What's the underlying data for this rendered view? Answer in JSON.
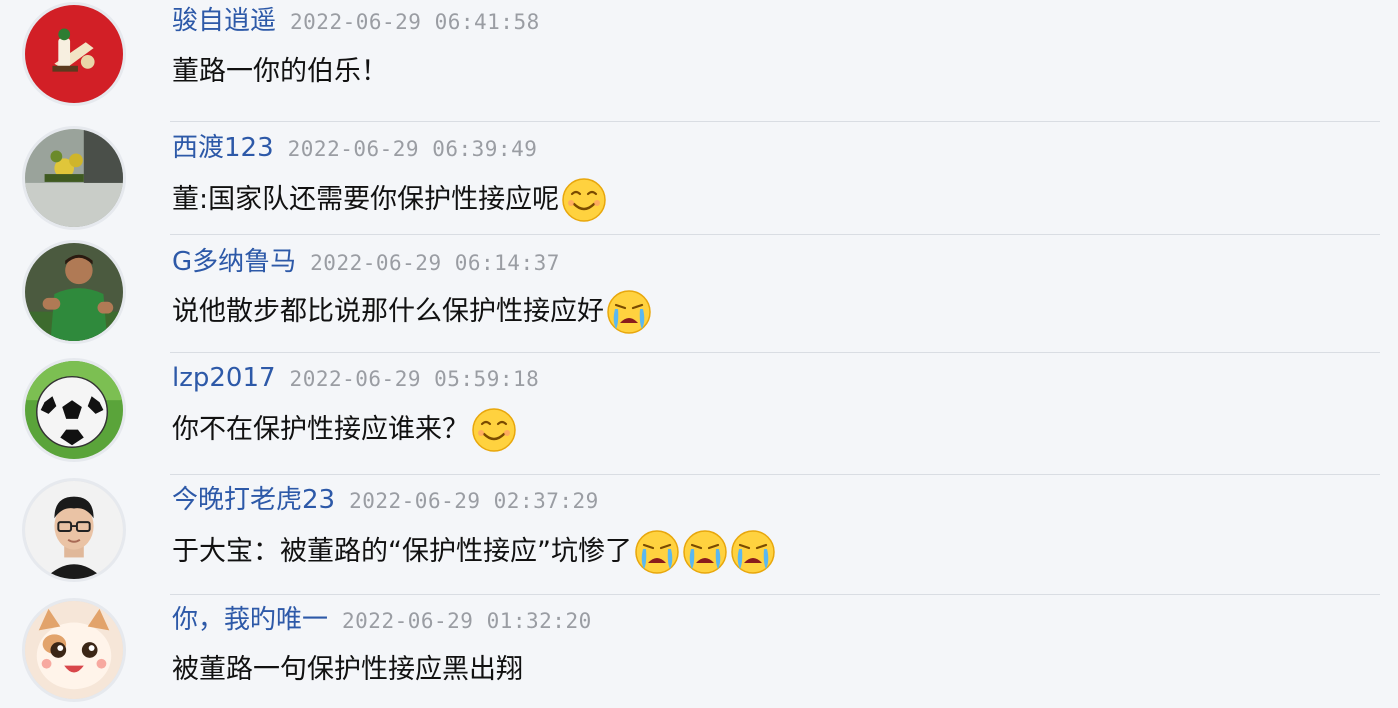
{
  "comments": [
    {
      "username": "骏自逍遥",
      "timestamp": "2022-06-29 06:41:58",
      "text": "董路一你的伯乐！",
      "avatar": "red-club-crest-avatar",
      "emojis": []
    },
    {
      "username": "西渡123",
      "timestamp": "2022-06-29 06:39:49",
      "text": "董:国家队还需要你保护性接应呢",
      "avatar": "yellow-flower-photo-avatar",
      "emojis": [
        "smirk-emoji"
      ]
    },
    {
      "username": "G多纳鲁马",
      "timestamp": "2022-06-29 06:14:37",
      "text": "说他散步都比说那什么保护性接应好",
      "avatar": "goalkeeper-photo-avatar",
      "emojis": [
        "crying-emoji"
      ]
    },
    {
      "username": "lzp2017",
      "timestamp": "2022-06-29 05:59:18",
      "text": "你不在保护性接应谁来？",
      "avatar": "soccer-ball-avatar",
      "emojis": [
        "smirk-emoji"
      ]
    },
    {
      "username": "今晚打老虎23",
      "timestamp": "2022-06-29 02:37:29",
      "text": "于大宝：被董路的“保护性接应”坑惨了",
      "avatar": "man-with-glasses-avatar",
      "emojis": [
        "crying-emoji",
        "crying-emoji",
        "crying-emoji"
      ]
    },
    {
      "username": "你，莪旳唯一",
      "timestamp": "2022-06-29 01:32:20",
      "text": "被董路一句保护性接应黑出翔",
      "avatar": "cartoon-cat-avatar",
      "emojis": []
    }
  ]
}
